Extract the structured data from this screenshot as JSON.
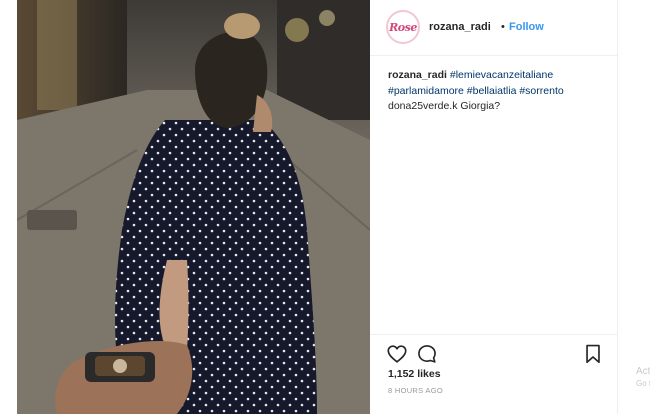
{
  "post": {
    "username": "rozana_radi",
    "separator": "•",
    "follow_label": "Follow",
    "avatar_text": "Rose",
    "caption": {
      "username": "rozana_radi",
      "hashtags": [
        "#lemievacanzeitaliane",
        "#parlamidamore",
        "#bellaiatlia",
        "#sorrento"
      ]
    },
    "comment": {
      "username": "dona25verde.k",
      "text": "Giorgia?"
    },
    "likes": "1,152 likes",
    "time": "8 HOURS AGO",
    "icons": {
      "like": "heart-icon",
      "comment": "comment-icon",
      "save": "bookmark-icon"
    }
  },
  "watermark": {
    "line1": "Act",
    "line2": "Go t"
  }
}
